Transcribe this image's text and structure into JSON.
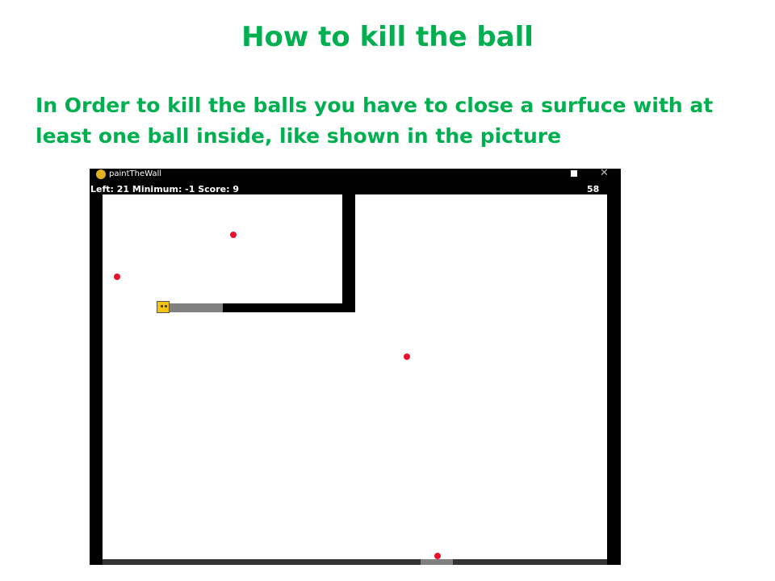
{
  "slide": {
    "title": "How to kill the ball",
    "description": "In Order to kill the balls you have to close a surfuce with at least one ball inside, like shown in the picture"
  },
  "window": {
    "title": "paintTheWall",
    "hud": "Left: 21  Minimum: -1  Score: 9",
    "timer": "58"
  },
  "colors": {
    "heading": "#00b050",
    "ball": "#e8102a",
    "wall": "#000000",
    "trail": "#808080",
    "player": "#f2c30f"
  }
}
